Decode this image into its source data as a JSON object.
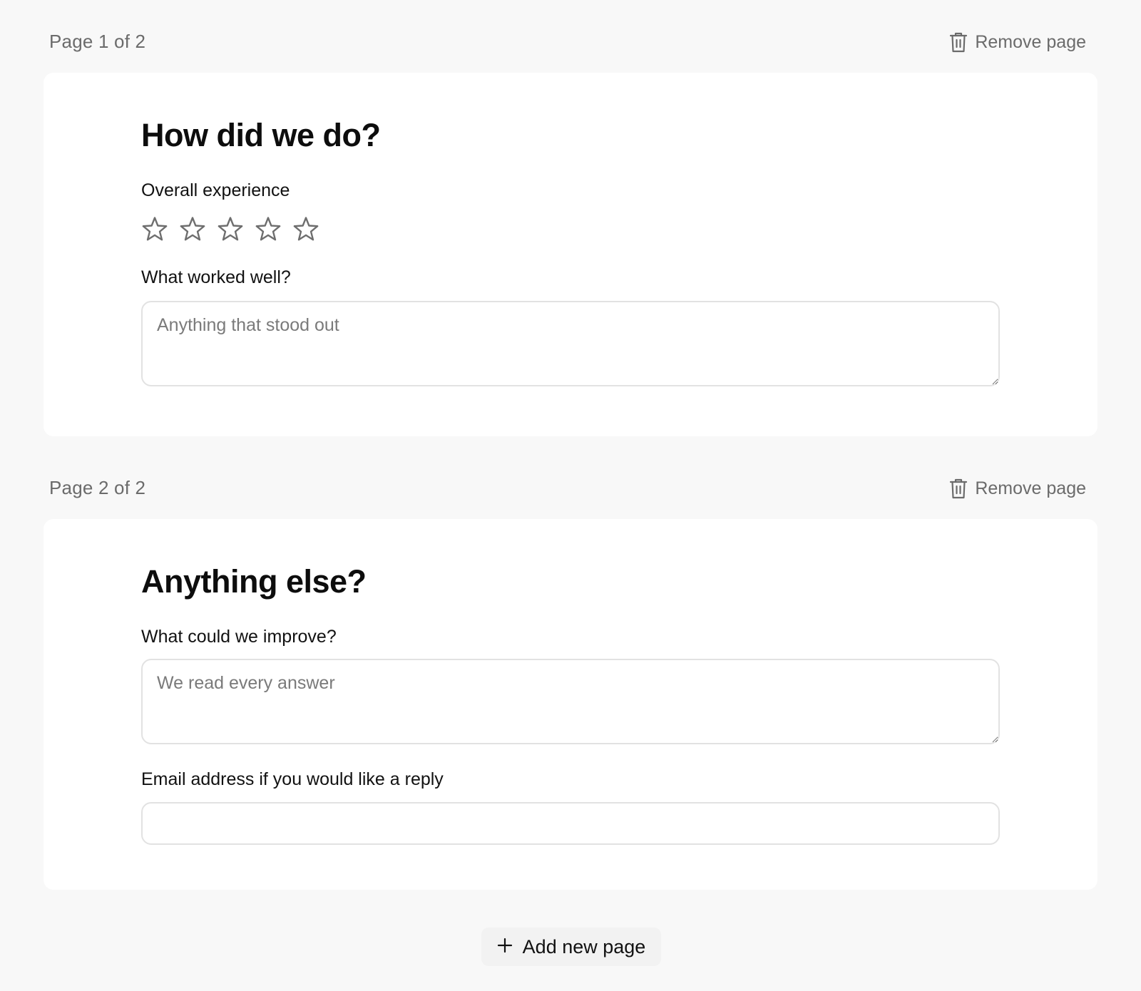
{
  "pages": [
    {
      "indicator": "Page 1 of 2",
      "remove_label": "Remove page",
      "title": "How did we do?",
      "rating": {
        "label": "Overall experience",
        "max": 5,
        "value": 0
      },
      "comment": {
        "label": "What worked well?",
        "placeholder": "Anything that stood out",
        "value": ""
      }
    },
    {
      "indicator": "Page 2 of 2",
      "remove_label": "Remove page",
      "title": "Anything else?",
      "improve": {
        "label": "What could we improve?",
        "placeholder": "We read every answer",
        "value": ""
      },
      "email": {
        "label": "Email address if you would like a reply",
        "value": ""
      }
    }
  ],
  "add_page_label": "Add new page",
  "colors": {
    "background": "#f8f8f8",
    "card": "#ffffff",
    "muted_text": "#6b6b6b",
    "border": "#e2e2e2",
    "star_outline": "#6e6e6e"
  }
}
